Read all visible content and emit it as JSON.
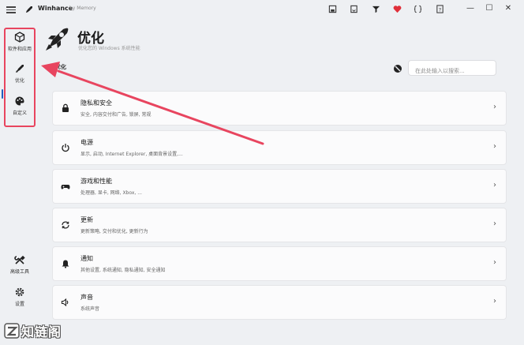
{
  "app": {
    "title": "Winhance",
    "subtitle": "by Memory",
    "icons": [
      "save-icon",
      "import-icon",
      "filter-icon",
      "heart-icon",
      "bracket-icon",
      "help-icon"
    ],
    "window_buttons": [
      "—",
      "☐",
      "✕"
    ]
  },
  "sidebar": {
    "top_items": [
      {
        "label": "软件和应用",
        "icon": "package-icon"
      },
      {
        "label": "优化",
        "icon": "rocket-icon"
      },
      {
        "label": "自定义",
        "icon": "palette-icon"
      }
    ],
    "bottom_items": [
      {
        "label": "高级工具",
        "icon": "tools-icon"
      },
      {
        "label": "设置",
        "icon": "gear-icon"
      }
    ]
  },
  "header": {
    "title": "优化",
    "subtitle": "优化您的 Windows 系统性能",
    "section": "优化"
  },
  "search": {
    "placeholder": "在此处输入以搜索..."
  },
  "cards": [
    {
      "title": "隐私和安全",
      "desc": "安全, 内容交付和广告, 锁屏, 常规",
      "icon": "lock-icon"
    },
    {
      "title": "电源",
      "desc": "显示, 启动, Internet Explorer, 桌面背景设置,...",
      "icon": "power-icon"
    },
    {
      "title": "游戏和性能",
      "desc": "处理器, 显卡, 网络, Xbox, ...",
      "icon": "gamepad-icon"
    },
    {
      "title": "更新",
      "desc": "更新策略, 交付和优化, 更新行为",
      "icon": "refresh-icon"
    },
    {
      "title": "通知",
      "desc": "其他设置, 系统通知, 隐私通知, 安全通知",
      "icon": "bell-icon"
    },
    {
      "title": "声音",
      "desc": "系统声音",
      "icon": "speaker-icon"
    }
  ],
  "colors": {
    "highlight": "#e8455f",
    "accent": "#1f5fbf",
    "heart": "#e0303a"
  },
  "watermark": {
    "text": "知链阁"
  }
}
